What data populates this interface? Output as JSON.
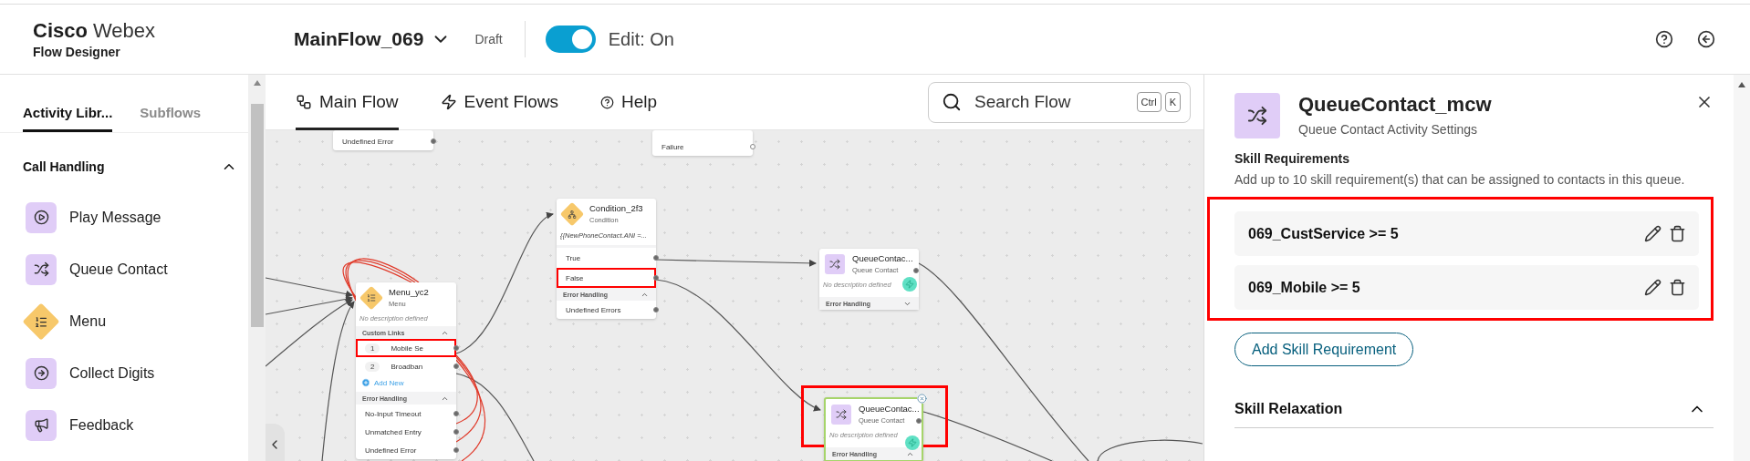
{
  "header": {
    "brand": "Cisco",
    "product": "Webex",
    "app": "Flow Designer",
    "flow_name": "MainFlow_069",
    "status": "Draft",
    "edit_toggle": {
      "label": "Edit: On",
      "on": true
    }
  },
  "sidebar": {
    "tabs": [
      {
        "label": "Activity Libr...",
        "selected": true
      },
      {
        "label": "Subflows",
        "selected": false
      }
    ],
    "section": {
      "title": "Call Handling",
      "expanded": true
    },
    "items": [
      {
        "label": "Play Message",
        "kind": "play"
      },
      {
        "label": "Queue Contact",
        "kind": "queue"
      },
      {
        "label": "Menu",
        "kind": "menu"
      },
      {
        "label": "Collect Digits",
        "kind": "digits"
      },
      {
        "label": "Feedback",
        "kind": "feedback"
      }
    ]
  },
  "canvas": {
    "tabs": [
      {
        "label": "Main Flow",
        "kind": "flow",
        "selected": true
      },
      {
        "label": "Event Flows",
        "kind": "event",
        "selected": false
      },
      {
        "label": "Help",
        "kind": "help",
        "selected": false
      }
    ],
    "search": {
      "placeholder": "Search Flow",
      "keys": [
        "Ctrl",
        "K"
      ]
    },
    "nodes": [
      {
        "kind": "fragment",
        "outputs": [
          {
            "label": "Undefined Error",
            "highlighted": false
          }
        ]
      },
      {
        "kind": "fragment",
        "outputs": [
          {
            "label": "Failure",
            "highlighted": false
          }
        ]
      },
      {
        "kind": "menu",
        "title": "Menu_yc2",
        "type_label": "Menu",
        "description": "No description defined",
        "selected": false,
        "highlighted": false,
        "sections": [
          {
            "title": "Custom Links",
            "expanded": true,
            "rows": [
              {
                "number": "1",
                "label": "Mobile Se",
                "highlighted": true
              },
              {
                "number": "2",
                "label": "Broadban",
                "highlighted": false
              }
            ],
            "add_label": "Add New"
          },
          {
            "title": "Error Handling",
            "expanded": true,
            "rows": [
              {
                "label": "No-Input Timeout",
                "highlighted": false
              },
              {
                "label": "Unmatched Entry",
                "highlighted": false
              },
              {
                "label": "Undefined Error",
                "highlighted": false
              }
            ]
          }
        ]
      },
      {
        "kind": "condition",
        "title": "Condition_2f3",
        "type_label": "Condition",
        "expression": "{{NewPhoneContact.ANI =...",
        "selected": false,
        "highlighted": false,
        "outputs": [
          {
            "label": "True",
            "highlighted": false
          },
          {
            "label": "False",
            "highlighted": true
          }
        ],
        "sections": [
          {
            "title": "Error Handling",
            "expanded": true,
            "rows": [
              {
                "label": "Undefined Errors",
                "highlighted": false
              }
            ]
          }
        ]
      },
      {
        "kind": "queue",
        "title": "QueueContac...",
        "type_label": "Queue Contact",
        "description": "No description defined",
        "selected": false,
        "highlighted": false,
        "sections": [
          {
            "title": "Error Handling",
            "expanded": false
          }
        ]
      },
      {
        "kind": "queue",
        "title": "QueueContac...",
        "type_label": "Queue Contact",
        "description": "No description defined",
        "selected": true,
        "highlighted": true,
        "sections": [
          {
            "title": "Error Handling",
            "expanded": true
          }
        ]
      }
    ]
  },
  "panel": {
    "title": "QueueContact_mcw",
    "subtitle": "Queue Contact Activity Settings",
    "skill_requirements": {
      "title": "Skill Requirements",
      "description": "Add up to 10 skill requirement(s) that can be assigned to contacts in this queue.",
      "highlighted": true,
      "items": [
        {
          "label": "069_CustService >= 5"
        },
        {
          "label": "069_Mobile >= 5"
        }
      ],
      "add_button": "Add Skill Requirement"
    },
    "skill_relaxation": {
      "title": "Skill Relaxation",
      "expanded": true
    }
  }
}
